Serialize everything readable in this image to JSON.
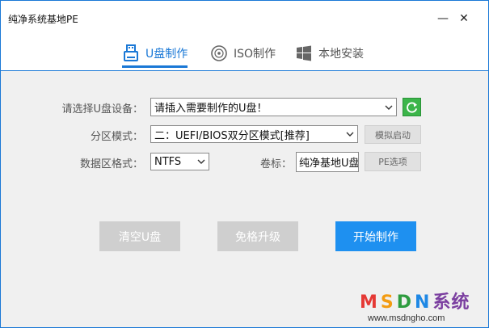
{
  "window": {
    "title": "纯净系统基地PE",
    "minimize_glyph": "—",
    "close_glyph": "✕"
  },
  "tabs": [
    {
      "label": "U盘制作",
      "icon": "usb-icon",
      "active": true
    },
    {
      "label": "ISO制作",
      "icon": "disc-icon",
      "active": false
    },
    {
      "label": "本地安装",
      "icon": "windows-icon",
      "active": false
    }
  ],
  "form": {
    "device_label": "请选择U盘设备：",
    "device_value": "请插入需要制作的U盘！",
    "partition_label": "分区模式：",
    "partition_value": "二：UEFI/BIOS双分区模式[推荐]",
    "simulate_label": "模拟启动",
    "format_label": "数据区格式：",
    "format_value": "NTFS",
    "volume_label": "卷标：",
    "volume_value": "纯净基地U盘",
    "pe_options_label": "PE选项"
  },
  "actions": {
    "clear_label": "清空U盘",
    "upgrade_label": "免格升级",
    "start_label": "开始制作"
  },
  "brand": {
    "m": "M",
    "s": "S",
    "d": "D",
    "n": "N",
    "x": "系统",
    "url": "www.msdngho.com"
  },
  "colors": {
    "accent": "#1a78d6",
    "primary_button": "#1e90f0",
    "refresh": "#3cb54a"
  }
}
